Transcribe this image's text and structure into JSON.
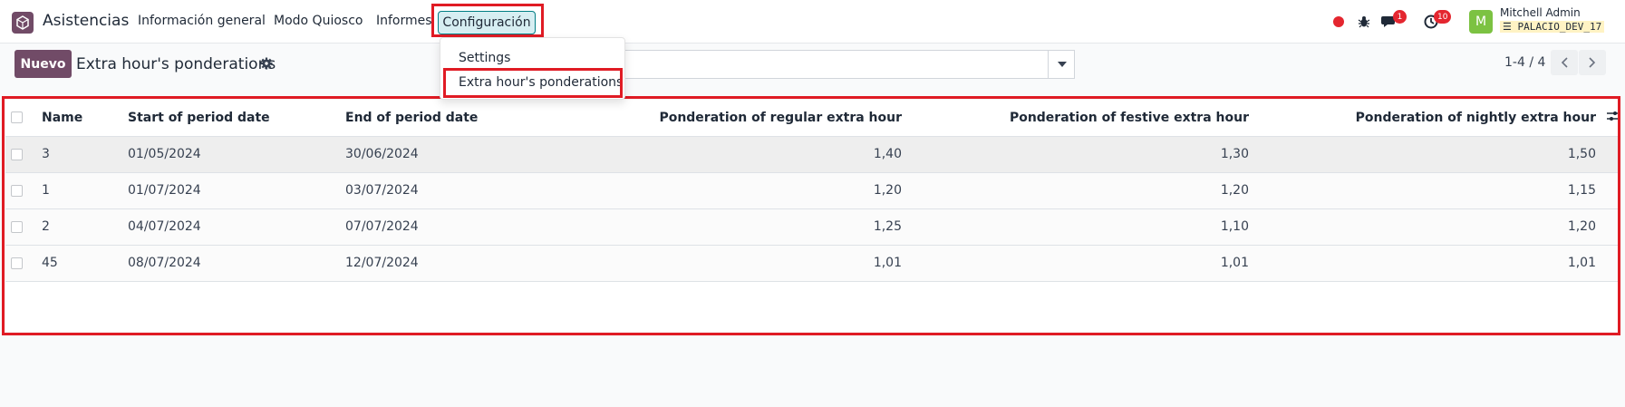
{
  "navbar": {
    "app_name": "Asistencias",
    "menu": [
      "Información general",
      "Modo Quiosco",
      "Informes",
      "Configuración"
    ],
    "chat_badge": "1",
    "activity_badge": "10",
    "user_name": "Mitchell Admin",
    "database": "PALACIO_DEV_17",
    "avatar_letter": "M"
  },
  "dropdown": {
    "items": [
      "Settings",
      "Extra hour's ponderations"
    ]
  },
  "control": {
    "new_label": "Nuevo",
    "title": "Extra hour's ponderations",
    "pager": "1-4 / 4"
  },
  "table": {
    "columns": [
      "Name",
      "Start of period date",
      "End of period date",
      "Ponderation of regular extra hour",
      "Ponderation of festive extra hour",
      "Ponderation of nightly extra hour"
    ],
    "rows": [
      {
        "name": "3",
        "start": "01/05/2024",
        "end": "30/06/2024",
        "regular": "1,40",
        "festive": "1,30",
        "nightly": "1,50"
      },
      {
        "name": "1",
        "start": "01/07/2024",
        "end": "03/07/2024",
        "regular": "1,20",
        "festive": "1,20",
        "nightly": "1,15"
      },
      {
        "name": "2",
        "start": "04/07/2024",
        "end": "07/07/2024",
        "regular": "1,25",
        "festive": "1,10",
        "nightly": "1,20"
      },
      {
        "name": "45",
        "start": "08/07/2024",
        "end": "12/07/2024",
        "regular": "1,01",
        "festive": "1,01",
        "nightly": "1,01"
      }
    ]
  },
  "colors": {
    "brand": "#714B67",
    "highlight": "#e01b24",
    "active_menu_bg": "#d6eef2"
  }
}
